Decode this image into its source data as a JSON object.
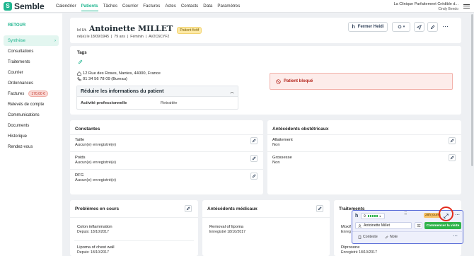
{
  "topbar": {
    "logo_text": "Semble",
    "nav": [
      "Calendrier",
      "Patients",
      "Tâches",
      "Courrier",
      "Factures",
      "Actes",
      "Contacts",
      "Data",
      "Paramètres"
    ],
    "clinic_name": "La Clinique Parfaitement Crédible d...",
    "user_name": "Cindy Bendo"
  },
  "sidebar": {
    "back": "RETOUR",
    "items": [
      {
        "label": "Synthèse"
      },
      {
        "label": "Consultations"
      },
      {
        "label": "Traitements"
      },
      {
        "label": "Courrier"
      },
      {
        "label": "Ordonnances"
      },
      {
        "label": "Factures",
        "badge": "170,00 €"
      },
      {
        "label": "Relevés de compte"
      },
      {
        "label": "Communications"
      },
      {
        "label": "Documents"
      },
      {
        "label": "Historique"
      },
      {
        "label": "Rendez-vous"
      }
    ]
  },
  "patient": {
    "id_label": "Id Ut.",
    "name": "Antoinette MILLET",
    "tag": "Patient fictif",
    "born": "né(e) le 18/09/1945",
    "age": "79 ans",
    "sex": "Féminin",
    "code": "AV2C6CYF2",
    "close_button": "Fermer Heidi"
  },
  "info": {
    "tags_title": "Tags",
    "address": "12 Rue des Roses, Nantes, 44000, France",
    "phone": "01 34 56 78 09 (Bureau)",
    "collapse_title": "Réduire les informations du patient",
    "occupation_label": "Activité professionnelle",
    "occupation_value": "Retraitée",
    "blocked": "Patient bloqué"
  },
  "constantes": {
    "title": "Constantes",
    "rows": [
      {
        "label": "Taille",
        "value": "Aucun(e) enregistré(e)"
      },
      {
        "label": "Poids",
        "value": "Aucun(e) enregistré(e)"
      },
      {
        "label": "DFG",
        "value": "Aucun(e) enregistré(e)"
      }
    ]
  },
  "obstetric": {
    "title": "Antécédents obstétricaux",
    "rows": [
      {
        "label": "Allaitement",
        "value": "Non"
      },
      {
        "label": "Grossesse",
        "value": "Non"
      }
    ]
  },
  "problems": {
    "title": "Problèmes en cours",
    "rows": [
      {
        "label": "Colon inflammation",
        "value": "Depuis: 18/10/2017"
      },
      {
        "label": "Lipoma of chest wall",
        "value": "Depuis: 18/10/2017"
      }
    ]
  },
  "medical": {
    "title": "Antécédents médicaux",
    "rows": [
      {
        "label": "Removal of lipoma",
        "value": "Enregistré 18/10/2017"
      }
    ]
  },
  "treatments": {
    "title": "Traitements",
    "rows": [
      {
        "label": "Moxif",
        "value": "Enreg"
      },
      {
        "label": "Diprosone",
        "value": "Enregistré 18/10/2017"
      }
    ]
  },
  "widget": {
    "timer": "28h jours",
    "patient_name": "Antoinette Millet",
    "start_button": "Commencer la visite",
    "context_label": "Contexte",
    "note_label": "Note"
  },
  "colors": {
    "brand": "#1fb58f",
    "blocked_bg": "#fdecea",
    "blocked_text": "#b4261c",
    "widget_border": "#5a6dd8",
    "start_button": "#2fb34a",
    "highlight_circle": "#e32a1c"
  }
}
